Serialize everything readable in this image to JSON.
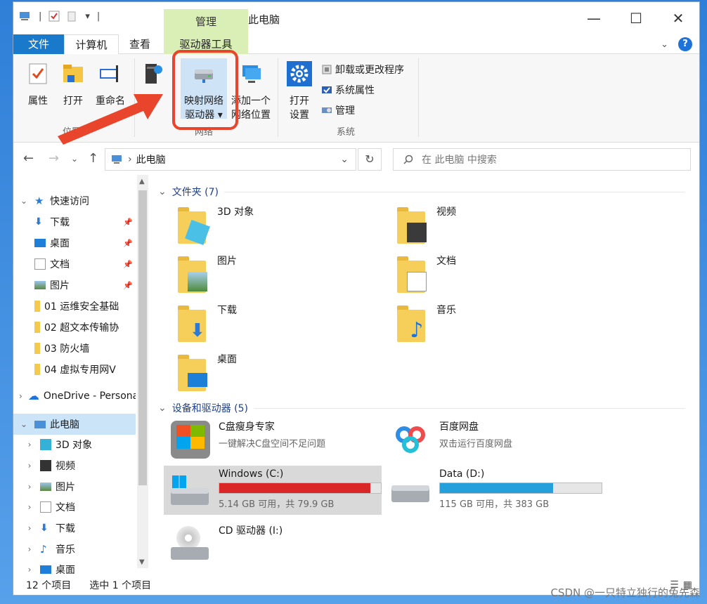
{
  "window": {
    "title": "此电脑",
    "context_tab_header": "管理"
  },
  "tabs": {
    "file": "文件",
    "computer": "计算机",
    "view": "查看",
    "drive_tools": "驱动器工具"
  },
  "ribbon": {
    "properties": "属性",
    "open": "打开",
    "rename": "重命名",
    "access_media": "访",
    "map_drive_line1": "映射网络",
    "map_drive_line2": "驱动器",
    "add_location_line1": "添加一个",
    "add_location_line2": "网络位置",
    "open_settings_line1": "打开",
    "open_settings_line2": "设置",
    "uninstall": "卸载或更改程序",
    "system_properties": "系统属性",
    "manage": "管理",
    "group_location": "位置",
    "group_network": "网络",
    "group_system": "系统"
  },
  "address": {
    "path": "此电脑",
    "search_placeholder": "在 此电脑 中搜索"
  },
  "sidebar": {
    "quick_access": "快速访问",
    "items": [
      {
        "label": "下载",
        "pinned": true
      },
      {
        "label": "桌面",
        "pinned": true
      },
      {
        "label": "文档",
        "pinned": true
      },
      {
        "label": "图片",
        "pinned": true
      },
      {
        "label": "01 运维安全基础"
      },
      {
        "label": "02 超文本传输协"
      },
      {
        "label": "03 防火墙"
      },
      {
        "label": "04 虚拟专用网V"
      }
    ],
    "onedrive": "OneDrive - Personal",
    "this_pc": "此电脑",
    "pc_items": [
      "3D 对象",
      "视频",
      "图片",
      "文档",
      "下载",
      "音乐",
      "桌面"
    ]
  },
  "content": {
    "folders_header": "文件夹 (7)",
    "folders": [
      "3D 对象",
      "视频",
      "图片",
      "文档",
      "下载",
      "音乐",
      "桌面"
    ],
    "devices_header": "设备和驱动器 (5)",
    "devices": [
      {
        "name": "C盘瘦身专家",
        "sub": "一键解决C盘空间不足问题"
      },
      {
        "name": "百度网盘",
        "sub": "双击运行百度网盘"
      },
      {
        "name": "Windows (C:)",
        "sub": "5.14 GB 可用，共 79.9 GB",
        "used_fraction": 0.936,
        "bar_color": "#da2626"
      },
      {
        "name": "Data (D:)",
        "sub": "115 GB 可用，共 383 GB",
        "used_fraction": 0.7,
        "bar_color": "#26a0da"
      },
      {
        "name": "CD 驱动器 (I:)"
      }
    ]
  },
  "status": {
    "count": "12 个项目",
    "selected": "选中 1 个项目"
  },
  "watermark": "CSDN @一只特立独行的兔先森"
}
